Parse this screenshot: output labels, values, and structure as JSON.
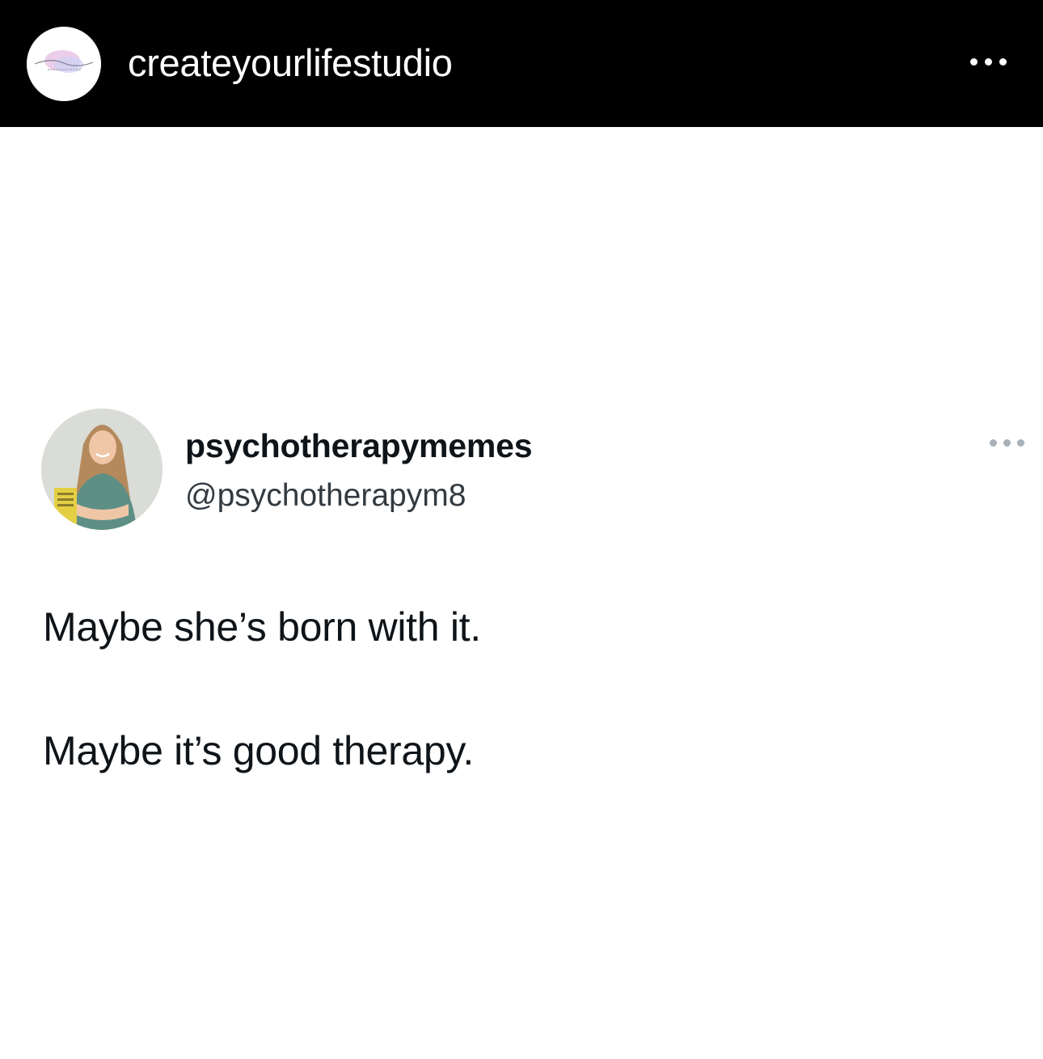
{
  "post_header": {
    "username": "createyourlifestudio",
    "avatar_icon": "studio-logo-avatar",
    "more_icon": "more-options-icon"
  },
  "tweet": {
    "display_name": "psychotherapymemes",
    "handle": "@psychotherapym8",
    "avatar_icon": "profile-photo-avatar",
    "more_icon": "more-options-icon",
    "lines": [
      "Maybe she’s born with it.",
      "Maybe it’s good therapy."
    ]
  },
  "colors": {
    "header_background": "#000000",
    "header_text": "#ffffff",
    "tweet_text": "#0f1419",
    "tweet_handle": "#333a40",
    "tweet_dots": "#a9b2ba"
  }
}
